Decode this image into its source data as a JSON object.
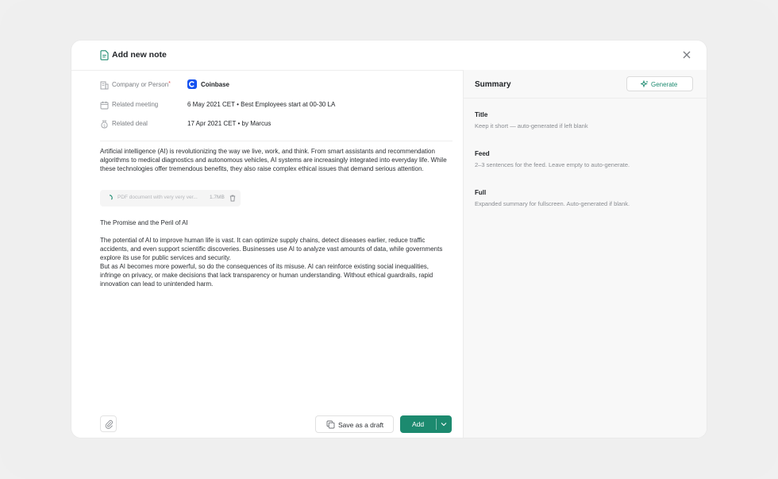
{
  "modal": {
    "title": "Add new note",
    "icon": "note-icon",
    "close_icon": "close-icon"
  },
  "meta": {
    "company": {
      "label": "Company or Person",
      "required_mark": "*",
      "value": "Coinbase",
      "icon": "building-icon",
      "logo_color": "#1652f0"
    },
    "meeting": {
      "label": "Related meeting",
      "date": "6 May 2021 CET",
      "separator": "•",
      "title": "Best Employees start at 00-30 LA",
      "icon": "calendar-icon"
    },
    "deal": {
      "label": "Related deal",
      "date": "17 Apr 2021 CET",
      "separator": "•",
      "owner": "by Marcus",
      "icon": "money-bag-icon"
    }
  },
  "note": {
    "paragraph1": "Artificial intelligence (AI) is revolutionizing the way we live, work, and think. From smart assistants and recommendation algorithms to medical diagnostics and autonomous vehicles, AI systems are increasingly integrated into everyday life. While these technologies offer tremendous benefits, they also raise complex ethical issues that demand serious attention.",
    "attachment": {
      "name": "PDF document with very very ver...",
      "size": "1.7MB",
      "status_icon": "loading-spinner-icon",
      "remove_icon": "trash-icon"
    },
    "heading": "The Promise and the Peril of AI",
    "paragraph2": "The potential of AI to improve human life is vast. It can optimize supply chains, detect diseases earlier, reduce traffic accidents, and even support scientific discoveries. Businesses use AI to analyze vast amounts of data, while governments explore its use for public services and security.",
    "paragraph3": "But as AI becomes more powerful, so do the consequences of its misuse. AI can reinforce existing social inequalities, infringe on privacy, or make decisions that lack transparency or human understanding. Without ethical guardrails, rapid innovation can lead to unintended harm."
  },
  "footer": {
    "attach_icon": "paperclip-icon",
    "draft_label": "Save as a draft",
    "draft_icon": "copy-icon",
    "add_label": "Add",
    "add_menu_icon": "chevron-down-icon"
  },
  "summary": {
    "title": "Summary",
    "generate_label": "Generate",
    "generate_icon": "sparkle-icon",
    "fields": [
      {
        "label": "Title",
        "placeholder": "Keep it short — auto-generated if left blank"
      },
      {
        "label": "Feed",
        "placeholder": "2–3 sentences for the feed. Leave empty to auto-generate."
      },
      {
        "label": "Full",
        "placeholder": "Expanded summary for fullscreen. Auto-generated if blank."
      }
    ]
  },
  "colors": {
    "accent": "#1c8a6f",
    "required": "#e04b4b",
    "background": "#efefef"
  }
}
